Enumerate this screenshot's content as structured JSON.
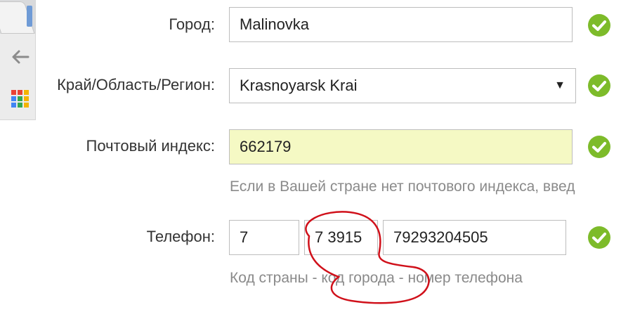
{
  "colors": {
    "check_green": "#7dbb2a",
    "highlight_yellow": "#f5f9c4",
    "annotation_red": "#d0101a",
    "label_text": "#333333",
    "hint_text": "#8a8a8a"
  },
  "browser": {
    "icons": [
      "back-arrow-icon",
      "apps-grid-icon"
    ]
  },
  "form": {
    "city": {
      "label": "Город:",
      "value": "Malinovka"
    },
    "region": {
      "label": "Край/Область/Регион:",
      "value": "Krasnoyarsk Krai",
      "arrow": "▼"
    },
    "postal": {
      "label": "Почтовый индекс:",
      "value": "662179",
      "hint": "Если в Вашей стране нет почтового индекса, введ"
    },
    "phone": {
      "label": "Телефон:",
      "country_code": "7",
      "city_code": "7 3915",
      "number": "79293204505",
      "hint": "Код страны - код города - номер телефона"
    }
  }
}
